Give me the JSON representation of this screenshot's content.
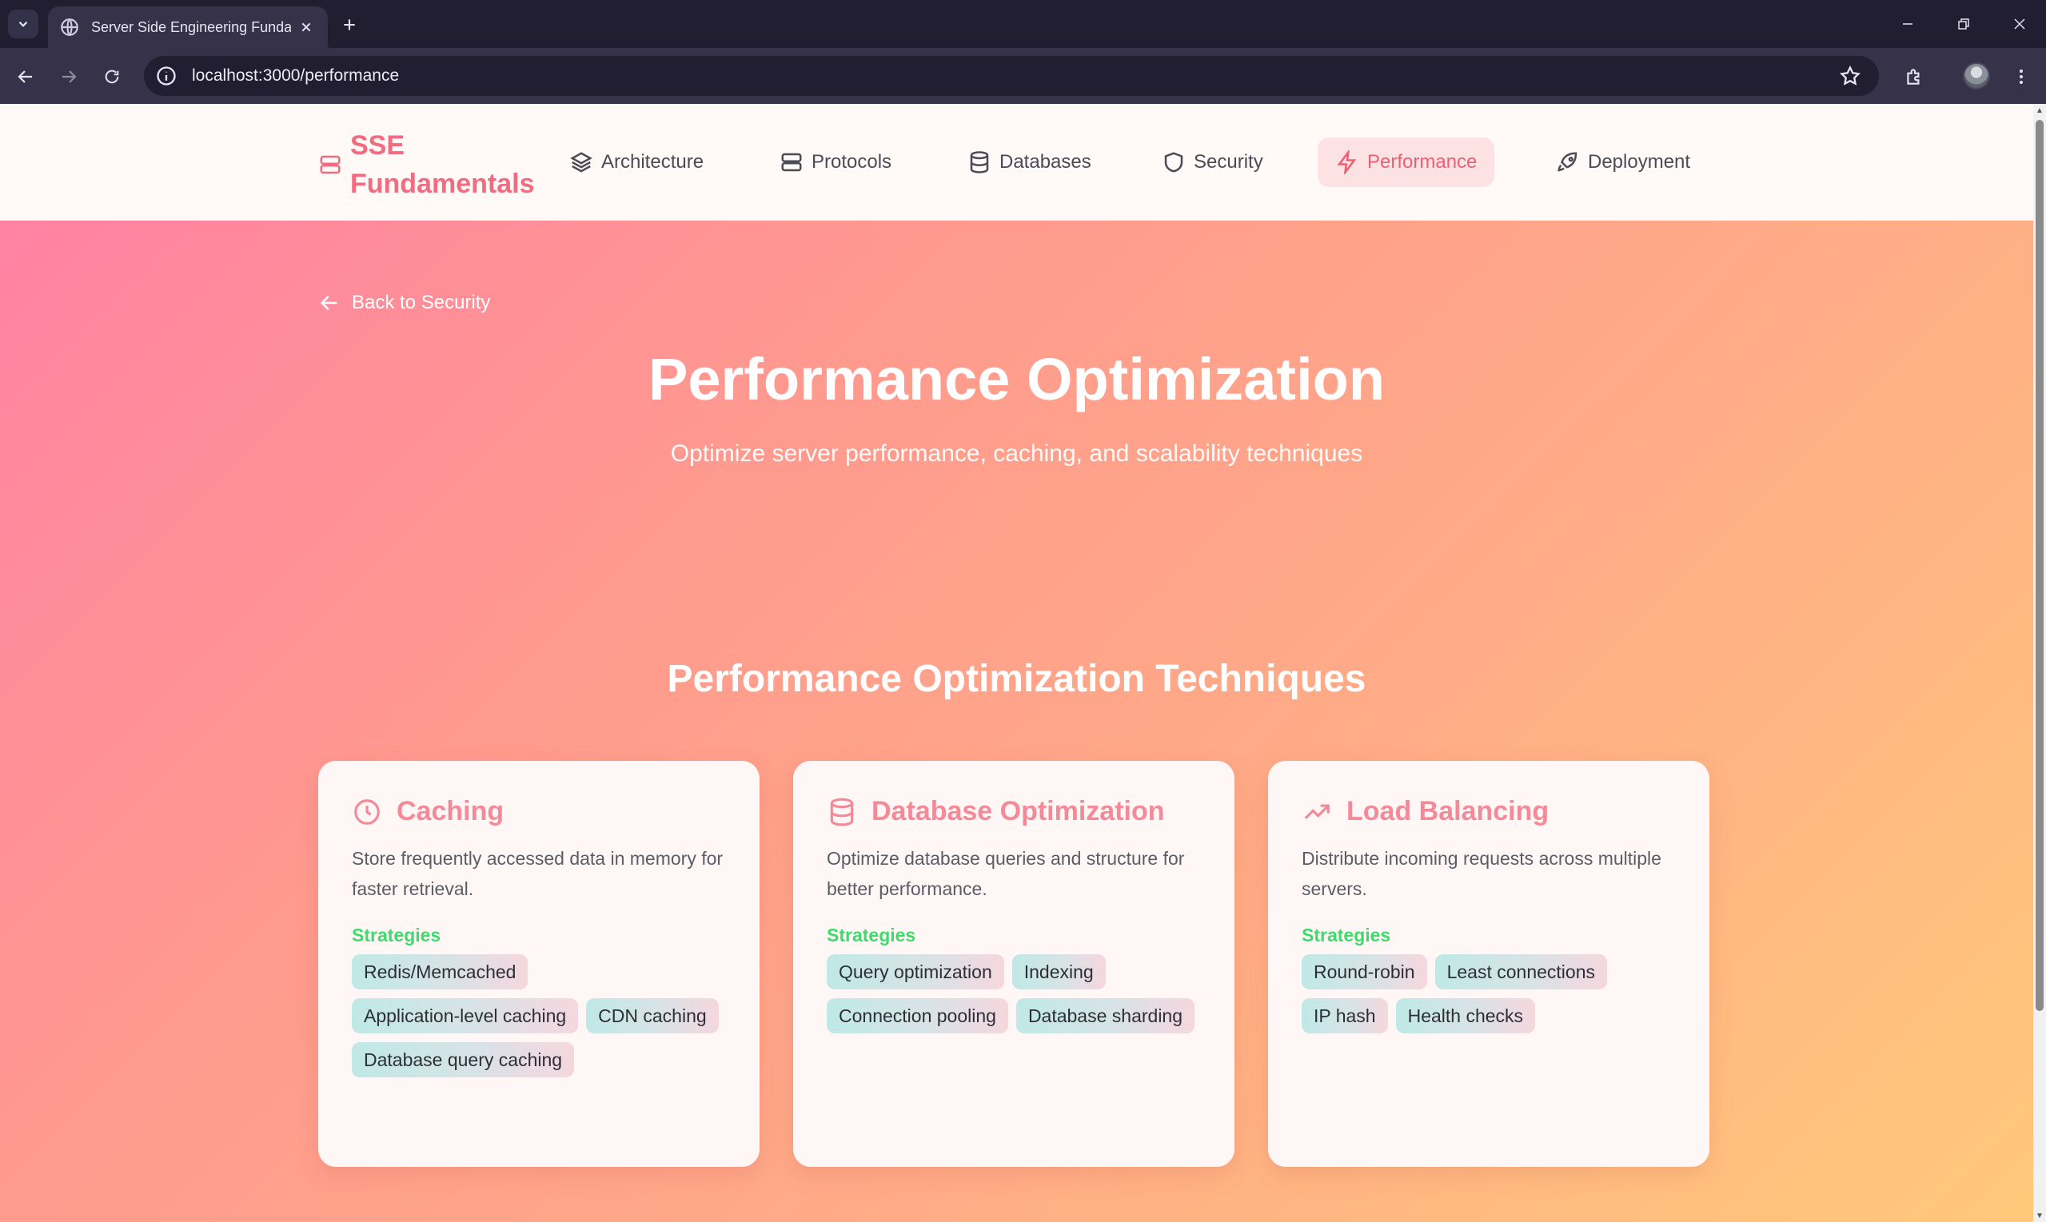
{
  "browser": {
    "tab_title": "Server Side Engineering Fundamentals",
    "url": "localhost:3000/performance"
  },
  "header": {
    "brand": "SSE Fundamentals",
    "nav": [
      {
        "label": "Architecture",
        "icon": "layers-icon"
      },
      {
        "label": "Protocols",
        "icon": "server-icon"
      },
      {
        "label": "Databases",
        "icon": "database-icon"
      },
      {
        "label": "Security",
        "icon": "shield-icon"
      },
      {
        "label": "Performance",
        "icon": "zap-icon",
        "active": true
      },
      {
        "label": "Deployment",
        "icon": "rocket-icon"
      }
    ]
  },
  "hero": {
    "back_label": "Back to Security",
    "title": "Performance Optimization",
    "subtitle": "Optimize server performance, caching, and scalability techniques"
  },
  "techniques": {
    "heading": "Performance Optimization Techniques",
    "strategies_label": "Strategies",
    "cards": [
      {
        "icon": "clock-icon",
        "title": "Caching",
        "description": "Store frequently accessed data in memory for faster retrieval.",
        "strategies": [
          "Redis/Memcached",
          "Application-level caching",
          "CDN caching",
          "Database query caching"
        ]
      },
      {
        "icon": "database-icon",
        "title": "Database Optimization",
        "description": "Optimize database queries and structure for better performance.",
        "strategies": [
          "Query optimization",
          "Indexing",
          "Connection pooling",
          "Database sharding"
        ]
      },
      {
        "icon": "trending-up-icon",
        "title": "Load Balancing",
        "description": "Distribute incoming requests across multiple servers.",
        "strategies": [
          "Round-robin",
          "Least connections",
          "IP hash",
          "Health checks"
        ]
      }
    ]
  },
  "colors": {
    "brand": "#f26b7e",
    "card_title": "#f48a97",
    "strategies_label": "#3ddc6a",
    "gradient_start": "#ff7fa5",
    "gradient_end": "#ffc97a"
  }
}
